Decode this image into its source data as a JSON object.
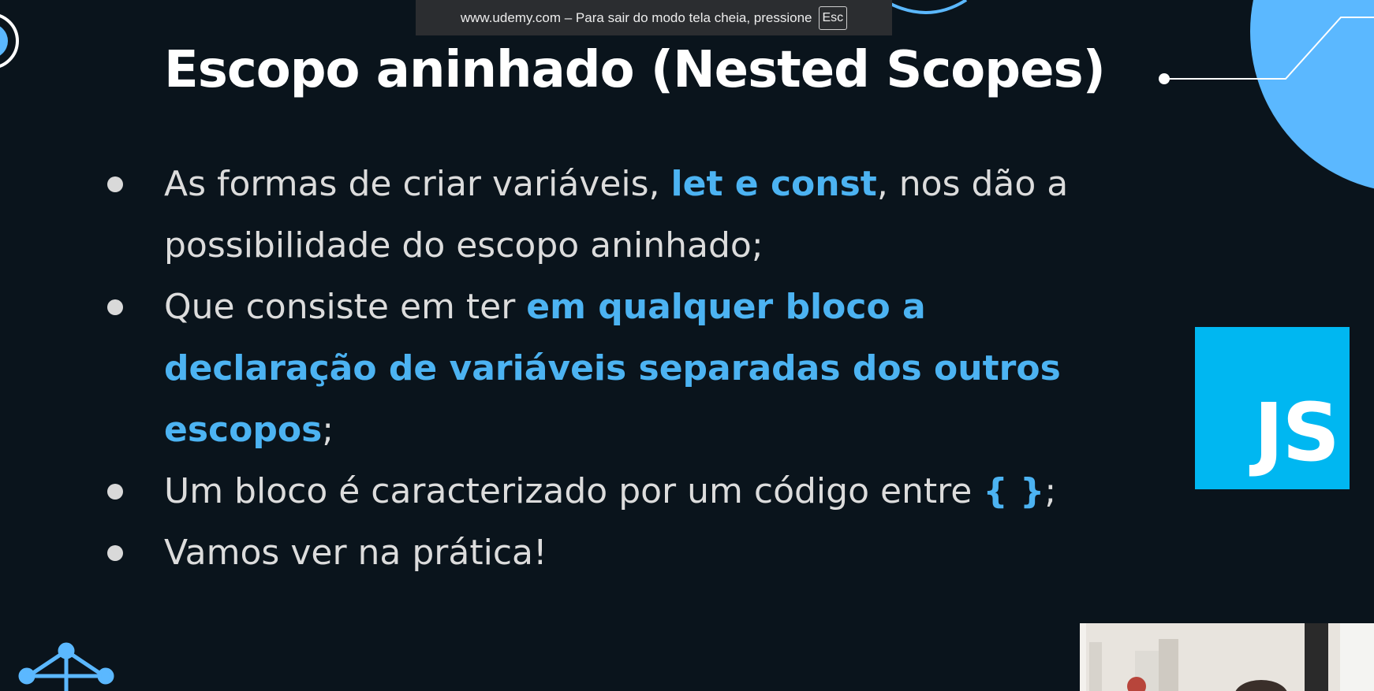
{
  "browser": {
    "fullscreen_notice": "www.udemy.com – Para sair do modo tela cheia, pressione",
    "esc_key": "Esc"
  },
  "slide": {
    "title": "Escopo aninhado (Nested Scopes)",
    "bullets": {
      "b1_text1": "As formas de criar variáveis, ",
      "b1_hl": "let e const",
      "b1_text2": ", nos dão a possibilidade do escopo aninhado;",
      "b2_text1": "Que consiste em ter ",
      "b2_hl": "em qualquer bloco a declaração de variáveis separadas dos outros escopos",
      "b2_text2": ";",
      "b3_text1": "Um bloco é caracterizado por um código entre ",
      "b3_hl": "{ }",
      "b3_text2": ";",
      "b4_text": "Vamos ver na prática!"
    },
    "logo_text": "JS"
  },
  "colors": {
    "background": "#0a141c",
    "highlight": "#4cb3f2",
    "js_logo": "#00b7f1",
    "decoration": "#5bb8ff"
  },
  "icons": {
    "network_logo": "network-node-icon"
  }
}
